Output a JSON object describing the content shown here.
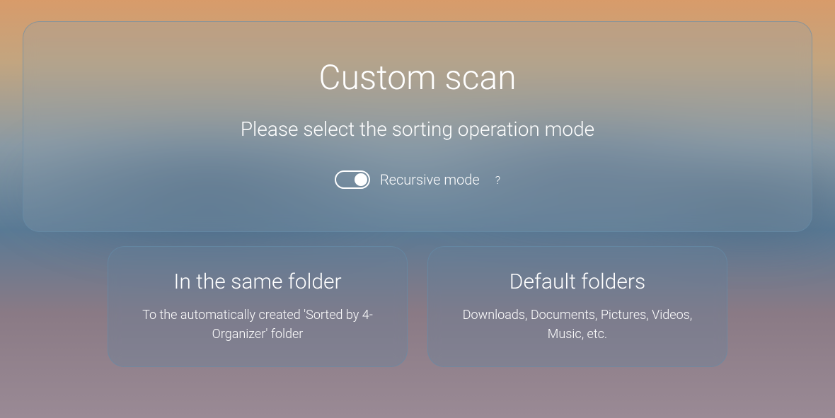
{
  "header": {
    "title": "Custom scan",
    "subtitle": "Please select the sorting operation mode",
    "toggle_label": "Recursive mode",
    "help_symbol": "?"
  },
  "options": [
    {
      "title": "In the same folder",
      "description": "To the automatically created 'Sorted by 4-Organizer' folder"
    },
    {
      "title": "Default folders",
      "description": "Downloads, Documents, Pictures, Videos, Music, etc."
    }
  ]
}
